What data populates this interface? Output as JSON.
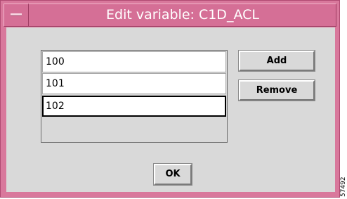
{
  "window": {
    "title": "Edit variable: C1D_ACL"
  },
  "list": {
    "items": [
      "100",
      "101",
      "102"
    ],
    "selected_index": 2
  },
  "buttons": {
    "add": "Add",
    "remove": "Remove",
    "ok": "OK"
  },
  "icons": {
    "window_menu": "window-menu-icon"
  },
  "figure_id": "57492",
  "colors": {
    "title_bar": "#d56f96",
    "dialog_bg": "#d9d9d9",
    "title_text": "#ffffff"
  }
}
